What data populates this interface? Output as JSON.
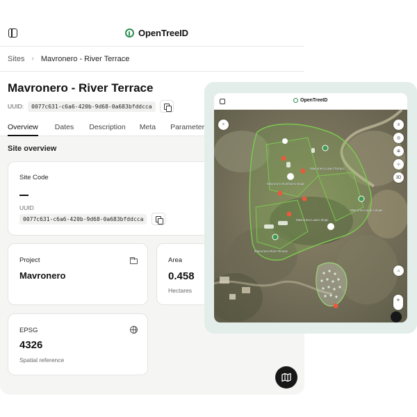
{
  "app": {
    "brand": "OpenTreeID",
    "breadcrumb": {
      "root": "Sites",
      "separator": "›",
      "current": "Mavronero - River Terrace"
    },
    "title": "Mavronero - River Terrace",
    "uuid_label": "UUID:",
    "uuid_value": "0077c631-c6a6-420b-9d68-0a683bfddcca",
    "tabs": [
      {
        "label": "Overview",
        "active": true
      },
      {
        "label": "Dates",
        "active": false
      },
      {
        "label": "Description",
        "active": false
      },
      {
        "label": "Meta",
        "active": false
      },
      {
        "label": "Parameters",
        "active": false
      }
    ],
    "section_title": "Site overview",
    "site_card": {
      "label": "Site Code",
      "value": "—",
      "uuid_label": "UUID",
      "uuid_value": "0077c631-c6a6-420b-9d68-0a683bfddcca"
    },
    "project_card": {
      "label": "Project",
      "value": "Mavronero",
      "icon": "folder-icon"
    },
    "area_card": {
      "label": "Area",
      "value": "0.458",
      "sub": "Hectares"
    },
    "epsg_card": {
      "label": "EPSG",
      "value": "4326",
      "sub": "Spatial reference",
      "icon": "globe-icon"
    },
    "map_button_icon": "map-icon"
  },
  "tablet": {
    "brand": "OpenTreeID",
    "map_labels": [
      "Mavronero Lower Terrace",
      "Mavronero Lower Slope",
      "Mavronero River Terrace",
      "Mavronero Upper Slope",
      "Mavronero Northwest Slope"
    ],
    "controls": [
      "layers-icon",
      "compass-icon",
      "locate-icon",
      "measure-icon",
      "3D"
    ],
    "zoom": {
      "in": "+",
      "out": "−"
    }
  },
  "colors": {
    "accent_green": "#2f8f52",
    "polygon_outline": "#7cc850",
    "background": "#f5f5f4",
    "fab": "#171717",
    "tablet_frame": "#e3eeea"
  }
}
